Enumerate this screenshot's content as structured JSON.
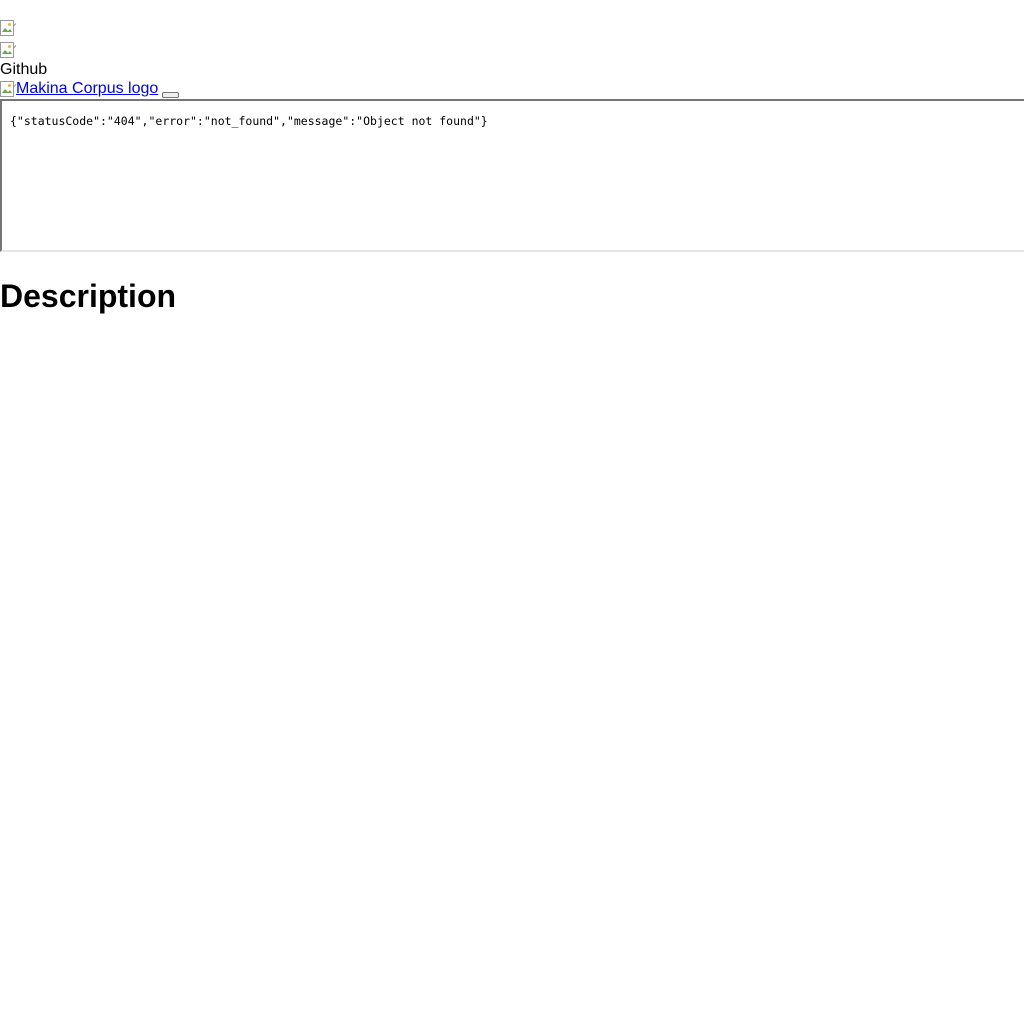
{
  "header": {
    "github_label": "Github",
    "logo_alt": "Makina Corpus logo"
  },
  "embed": {
    "response_text": "{\"statusCode\":\"404\",\"error\":\"not_found\",\"message\":\"Object not found\"}"
  },
  "main": {
    "heading": "Description"
  },
  "icons": {
    "broken_image": "broken-image-icon"
  }
}
